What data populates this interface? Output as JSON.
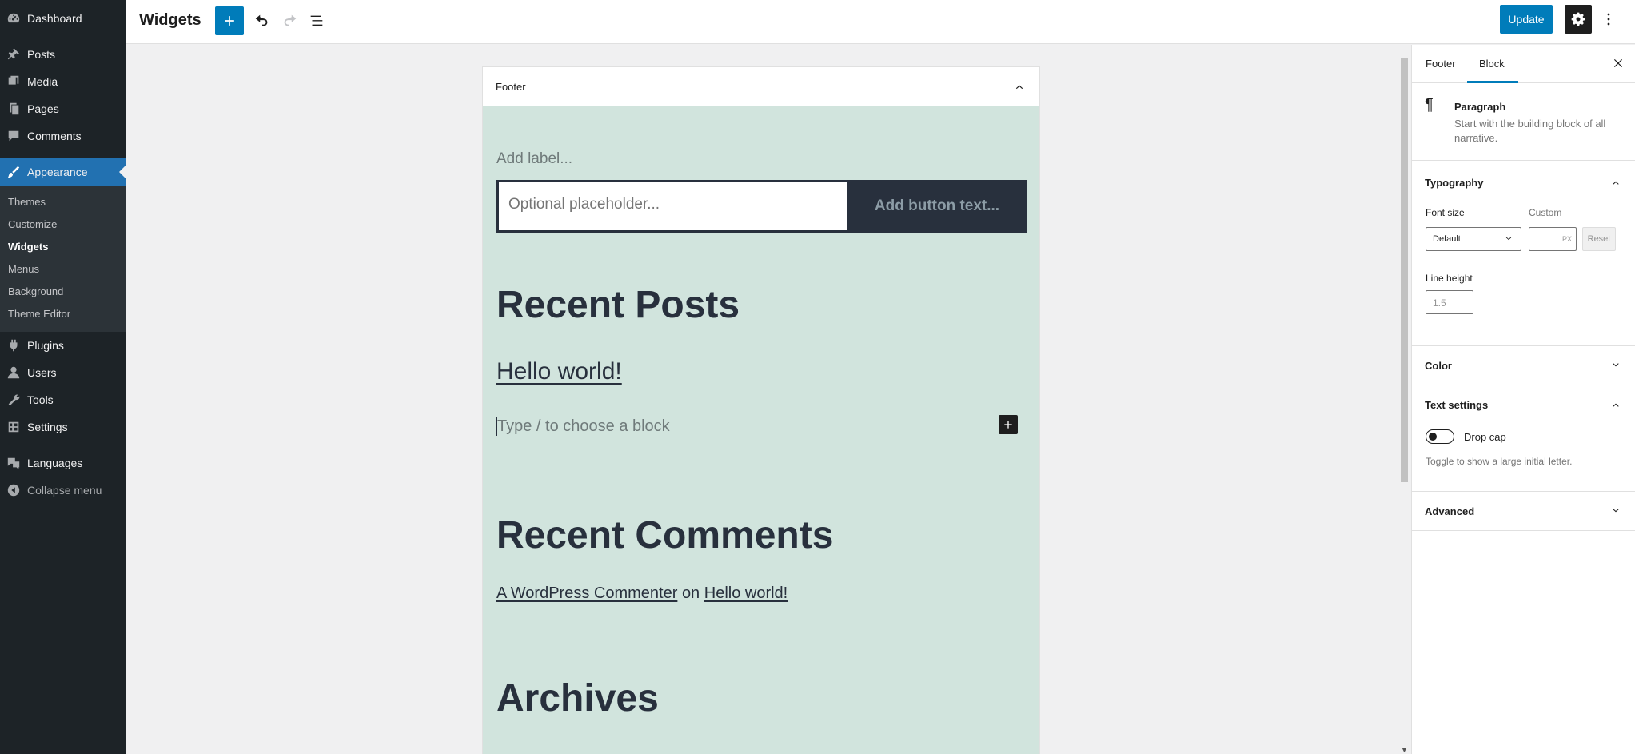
{
  "admin_menu": {
    "items": [
      {
        "label": "Dashboard",
        "icon": "dashboard-icon"
      },
      {
        "label": "Posts",
        "icon": "pin-icon"
      },
      {
        "label": "Media",
        "icon": "media-icon"
      },
      {
        "label": "Pages",
        "icon": "pages-icon"
      },
      {
        "label": "Comments",
        "icon": "comments-icon"
      },
      {
        "label": "Appearance",
        "icon": "brush-icon"
      },
      {
        "label": "Plugins",
        "icon": "plugin-icon"
      },
      {
        "label": "Users",
        "icon": "users-icon"
      },
      {
        "label": "Tools",
        "icon": "wrench-icon"
      },
      {
        "label": "Settings",
        "icon": "settings-icon"
      },
      {
        "label": "Languages",
        "icon": "languages-icon"
      }
    ],
    "appearance_submenu": [
      "Themes",
      "Customize",
      "Widgets",
      "Menus",
      "Background",
      "Theme Editor"
    ],
    "collapse_label": "Collapse menu"
  },
  "header": {
    "title": "Widgets",
    "update_label": "Update"
  },
  "editor": {
    "area_title": "Footer",
    "search": {
      "label_placeholder": "Add label...",
      "input_placeholder": "Optional placeholder...",
      "button_placeholder": "Add button text..."
    },
    "recent_posts": {
      "title": "Recent Posts",
      "post_link": "Hello world!"
    },
    "appender_placeholder": "Type / to choose a block",
    "recent_comments": {
      "title": "Recent Comments",
      "author": "A WordPress Commenter",
      "on": "on",
      "post": "Hello world!"
    },
    "archives_title": "Archives"
  },
  "sidebar": {
    "tabs": [
      "Footer",
      "Block"
    ],
    "active_tab": "Block",
    "block": {
      "icon_glyph": "¶",
      "title": "Paragraph",
      "description": "Start with the building block of all narrative."
    },
    "typography": {
      "title": "Typography",
      "font_size_label": "Font size",
      "custom_label": "Custom",
      "font_size_value": "Default",
      "unit": "PX",
      "reset_label": "Reset",
      "line_height_label": "Line height",
      "line_height_placeholder": "1.5"
    },
    "color_title": "Color",
    "text_settings": {
      "title": "Text settings",
      "drop_cap_label": "Drop cap",
      "drop_cap_help": "Toggle to show a large initial letter.",
      "drop_cap_enabled": false
    },
    "advanced_title": "Advanced"
  },
  "colors": {
    "admin_bg": "#1d2327",
    "accent": "#007cba",
    "canvas_bg": "#d1e4dd",
    "text_dark": "#28303d"
  }
}
